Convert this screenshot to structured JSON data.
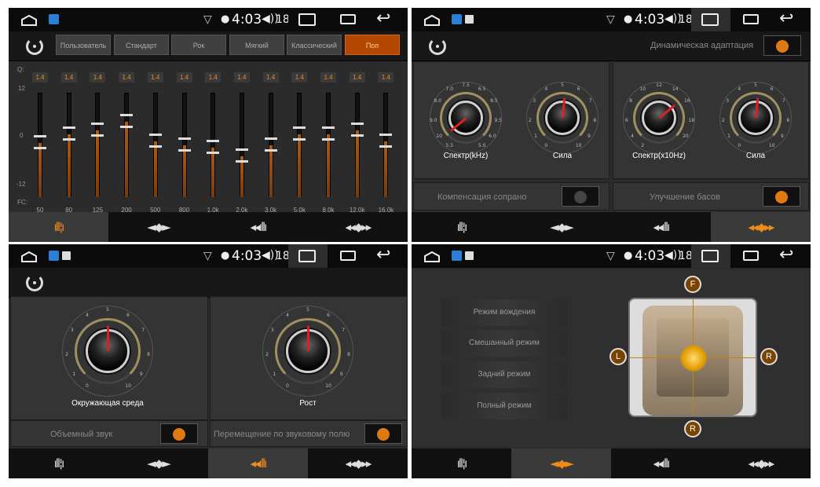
{
  "status": {
    "time": "4:03",
    "volume": "18"
  },
  "nav": [
    "ıll¦ı",
    "◄◆►",
    "◂◂ıllı",
    "◂◂◆▸▸"
  ],
  "eq": {
    "presets": [
      "Пользователь",
      "Стандарт",
      "Рок",
      "Мягкий",
      "Классический",
      "Поп"
    ],
    "active_preset": 5,
    "q_label": "Q:",
    "q_values": [
      "1.4",
      "1.4",
      "1.4",
      "1.4",
      "1.4",
      "1.4",
      "1.4",
      "1.4",
      "1.4",
      "1.4",
      "1.4",
      "1.4",
      "1.4"
    ],
    "scale": {
      "top": "12",
      "mid": "0",
      "bottom": "-12"
    },
    "fc_label": "FC:",
    "fc": [
      "50",
      "80",
      "125",
      "200",
      "500",
      "800",
      "1.0k",
      "2.0k",
      "3.0k",
      "5.0k",
      "8.0k",
      "12.0k",
      "16.0k"
    ],
    "gains": [
      0.5,
      2.5,
      3.5,
      5.5,
      1.0,
      0.0,
      -0.5,
      -2.5,
      0.0,
      2.5,
      2.5,
      3.5,
      1.0
    ]
  },
  "dsp": {
    "dynamic_label": "Динамическая адаптация",
    "knobs": [
      {
        "label": "Спектр(kHz)",
        "ticks": [
          "7.5",
          "7.0",
          "6.5",
          "8.0",
          "8.5",
          "9.0",
          "9.5",
          "10",
          "6.0",
          "5.5",
          "5.0"
        ],
        "value_deg": -130
      },
      {
        "label": "Сила",
        "ticks": [
          "5",
          "4",
          "6",
          "3",
          "7",
          "2",
          "8",
          "1",
          "9",
          "0",
          "10"
        ],
        "value_deg": 5
      },
      {
        "label": "Спектр(x10Hz)",
        "ticks": [
          "12",
          "10",
          "14",
          "8",
          "16",
          "6",
          "18",
          "4",
          "20",
          "2",
          ""
        ],
        "value_deg": 50
      },
      {
        "label": "Сила",
        "ticks": [
          "5",
          "4",
          "6",
          "3",
          "7",
          "2",
          "8",
          "1",
          "9",
          "0",
          "10"
        ],
        "value_deg": 5
      }
    ],
    "soprano_label": "Компенсация сопрано",
    "bass_label": "Улучшение басов",
    "soprano_on": false,
    "bass_on": true
  },
  "surround": {
    "knobs": [
      {
        "label": "Окружающая среда",
        "ticks": [
          "5",
          "4",
          "6",
          "3",
          "7",
          "2",
          "8",
          "1",
          "9",
          "0",
          "10"
        ]
      },
      {
        "label": "Рост",
        "ticks": [
          "5",
          "4",
          "6",
          "3",
          "7",
          "2",
          "8",
          "1",
          "9",
          "0",
          "10"
        ]
      }
    ],
    "volume_label": "Объемный звук",
    "field_label": "Перемещение по звуковому полю"
  },
  "balance": {
    "modes": [
      "Режим вождения",
      "Смешанный режим",
      "Задний режим",
      "Полный режим"
    ],
    "speakers": {
      "front": "F",
      "left": "L",
      "right": "R",
      "rear": "R"
    }
  },
  "colors": {
    "accent": "#f08a18",
    "needle": "#e02020",
    "bg": "#2b2b2b"
  }
}
